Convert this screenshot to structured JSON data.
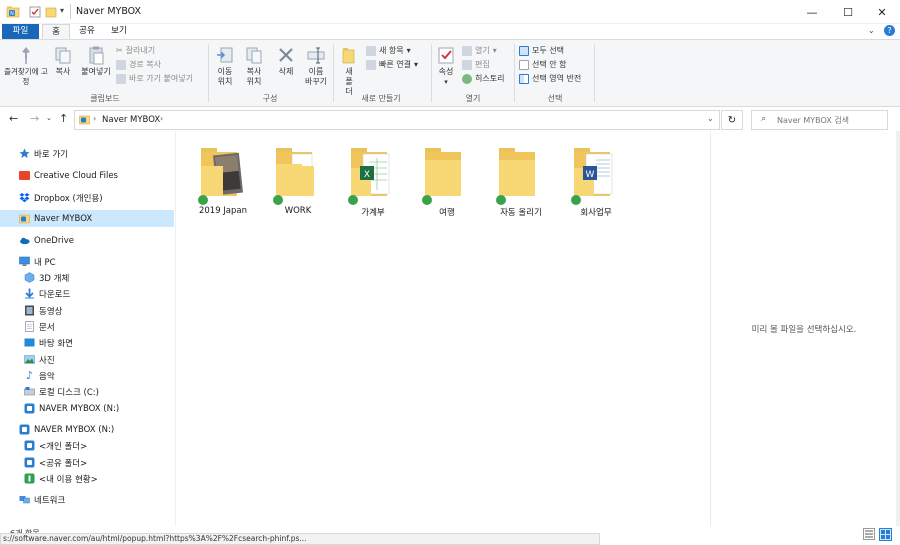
{
  "window": {
    "title": "Naver MYBOX",
    "controls": {
      "minimize": "—",
      "maximize": "☐",
      "close": "✕"
    }
  },
  "ribbon_tabs": [
    "파일",
    "홈",
    "공유",
    "보기"
  ],
  "ribbon": {
    "clipboard": {
      "pin_label": "즐겨찾기에 고정",
      "copy_label": "복사",
      "paste_label": "붙여넣기",
      "cut_label": "잘라내기",
      "copy_path_label": "경로 복사",
      "paste_shortcut_label": "바로 가기 붙여넣기",
      "group_label": "클립보드"
    },
    "organize": {
      "move_to_label": "이동 위치",
      "copy_to_label": "복사 위치",
      "delete_label": "삭제",
      "rename_label": "이름 바꾸기",
      "group_label": "구성"
    },
    "new": {
      "new_folder_label": "새 폴더",
      "new_item_label": "새 항목",
      "easy_access_label": "빠른 연결",
      "group_label": "새로 만들기"
    },
    "open": {
      "properties_label": "속성",
      "open_label": "열기",
      "edit_label": "편집",
      "history_label": "히스토리",
      "group_label": "열기"
    },
    "select": {
      "select_all_label": "모두 선택",
      "select_none_label": "선택 안 함",
      "invert_label": "선택 영역 반전",
      "group_label": "선택"
    }
  },
  "address_bar": {
    "path": [
      "Naver MYBOX"
    ],
    "search_placeholder": "Naver MYBOX 검색"
  },
  "nav_pane": {
    "quick_access": "바로 가기",
    "creative_cloud": "Creative Cloud Files",
    "dropbox": "Dropbox (개인용)",
    "naver_mybox": "Naver MYBOX",
    "onedrive": "OneDrive",
    "this_pc": "내 PC",
    "pc_items": [
      "3D 개체",
      "다운로드",
      "동영상",
      "문서",
      "바탕 화면",
      "사진",
      "음악",
      "로컬 디스크 (C:)",
      "NAVER MYBOX (N:)"
    ],
    "naver_drive": "NAVER MYBOX (N:)",
    "drive_items": [
      "<개인 폴더>",
      "<공유 폴더>",
      "<내 이용 현황>"
    ],
    "network": "네트워크"
  },
  "folders": [
    {
      "name": "2019 Japan",
      "kind": "photo"
    },
    {
      "name": "WORK",
      "kind": "docs"
    },
    {
      "name": "가계부",
      "kind": "excel"
    },
    {
      "name": "여행",
      "kind": "plain"
    },
    {
      "name": "자동 올리기",
      "kind": "plain"
    },
    {
      "name": "회사업무",
      "kind": "word"
    }
  ],
  "preview_message": "미리 볼 파일을 선택하십시오.",
  "status": {
    "item_count": "6개 항목",
    "tooltip_url": "s://software.naver.com/au/html/popup.html?https%3A%2F%2Fcsearch-phinf.ps..."
  },
  "colors": {
    "file_tab": "#1a66b8",
    "selection": "#cce8ff",
    "folder": "#f8d775",
    "sync_check": "#3aa24b"
  }
}
